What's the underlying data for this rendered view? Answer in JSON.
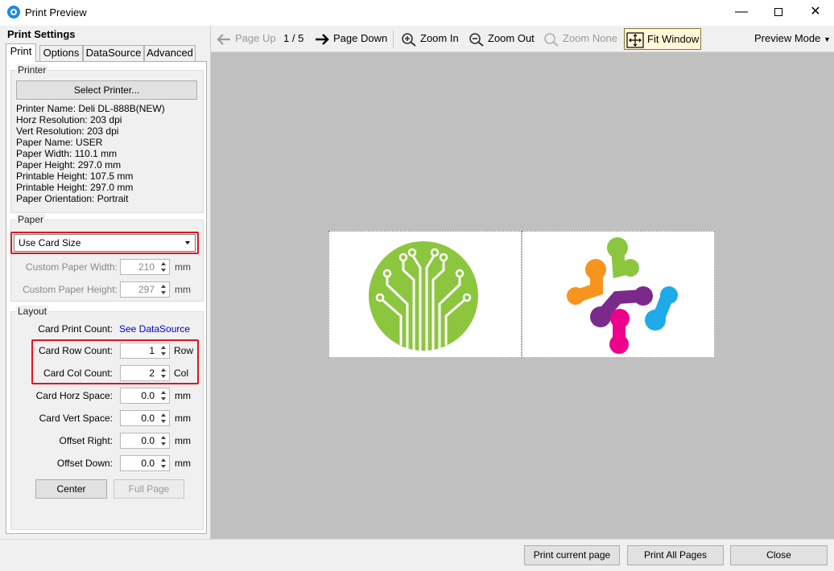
{
  "window": {
    "title": "Print Preview"
  },
  "toolbar": {
    "page_up": "Page Up",
    "page_indicator": "1 / 5",
    "page_down": "Page Down",
    "zoom_in": "Zoom In",
    "zoom_out": "Zoom Out",
    "zoom_none": "Zoom None",
    "fit_window": "Fit Window",
    "preview_mode": "Preview Mode"
  },
  "left_panel": {
    "heading": "Print Settings",
    "tabs": [
      "Print",
      "Options",
      "DataSource",
      "Advanced"
    ],
    "active_tab": "Print"
  },
  "printer": {
    "group_title": "Printer",
    "select_button": "Select Printer...",
    "info": [
      "Printer Name: Deli DL-888B(NEW)",
      "Horz Resolution: 203 dpi",
      "Vert Resolution: 203 dpi",
      "Paper Name: USER",
      "Paper Width: 110.1 mm",
      "Paper Height: 297.0 mm",
      "Printable Height: 107.5 mm",
      "Printable Height: 297.0 mm",
      "Paper Orientation: Portrait"
    ]
  },
  "paper": {
    "group_title": "Paper",
    "size_selected": "Use Card Size",
    "custom_width_label": "Custom Paper Width:",
    "custom_width_value": "210",
    "custom_height_label": "Custom Paper Height:",
    "custom_height_value": "297",
    "unit": "mm"
  },
  "layout": {
    "group_title": "Layout",
    "card_print_count_label": "Card Print Count:",
    "card_print_count_link": "See DataSource",
    "row_count_label": "Card Row Count:",
    "row_count_value": "1",
    "row_unit": "Row",
    "col_count_label": "Card Col Count:",
    "col_count_value": "2",
    "col_unit": "Col",
    "horz_space_label": "Card Horz Space:",
    "horz_space_value": "0.0",
    "vert_space_label": "Card Vert Space:",
    "vert_space_value": "0.0",
    "offset_right_label": "Offset Right:",
    "offset_right_value": "0.0",
    "offset_down_label": "Offset Down:",
    "offset_down_value": "0.0",
    "unit": "mm",
    "center_button": "Center",
    "full_page_button": "Full Page"
  },
  "footer": {
    "print_current": "Print current page",
    "print_all": "Print All Pages",
    "close": "Close"
  },
  "colors": {
    "highlight_border": "#e0141e",
    "logo_green": "#8cc63f",
    "dot_green": "#8cc63f",
    "dot_orange": "#f7941d",
    "dot_purple": "#7b2a8c",
    "dot_blue": "#1eaae7",
    "dot_pink": "#ec008c"
  }
}
